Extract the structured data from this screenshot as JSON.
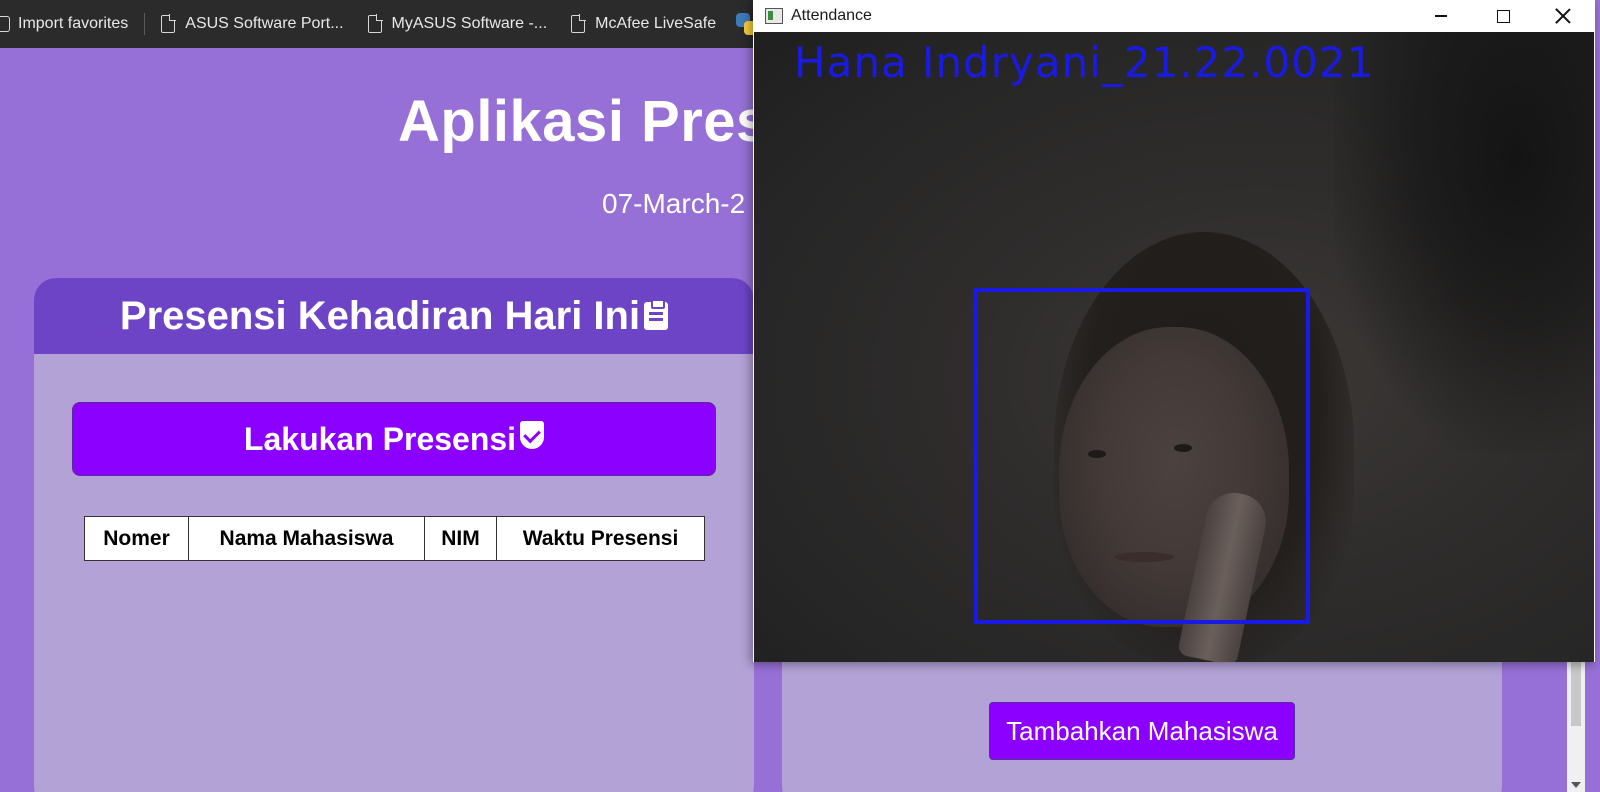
{
  "bookmarks": {
    "import_label": "Import favorites",
    "items": [
      {
        "label": "ASUS Software Port..."
      },
      {
        "label": "MyASUS Software -..."
      },
      {
        "label": "McAfee LiveSafe"
      }
    ]
  },
  "page": {
    "title": "Aplikasi Presensi",
    "date": "07-March-2",
    "attendance_card": {
      "header": "Presensi Kehadiran Hari Ini",
      "button_label": "Lakukan Presensi",
      "table_headers": [
        "Nomer",
        "Nama Mahasiswa",
        "NIM",
        "Waktu Presensi"
      ]
    },
    "student_card": {
      "button_label": "Tambahkan Mahasiswa"
    }
  },
  "window": {
    "title": "Attendance",
    "recognized_name": "Hana  Indryani_21.22.0021",
    "box_color": "#1a1ae6"
  },
  "colors": {
    "page_bg": "#9670d6",
    "card_bg": "#b3a2d6",
    "header_bg": "#6d44c6",
    "button_bg": "#8b00ff"
  }
}
